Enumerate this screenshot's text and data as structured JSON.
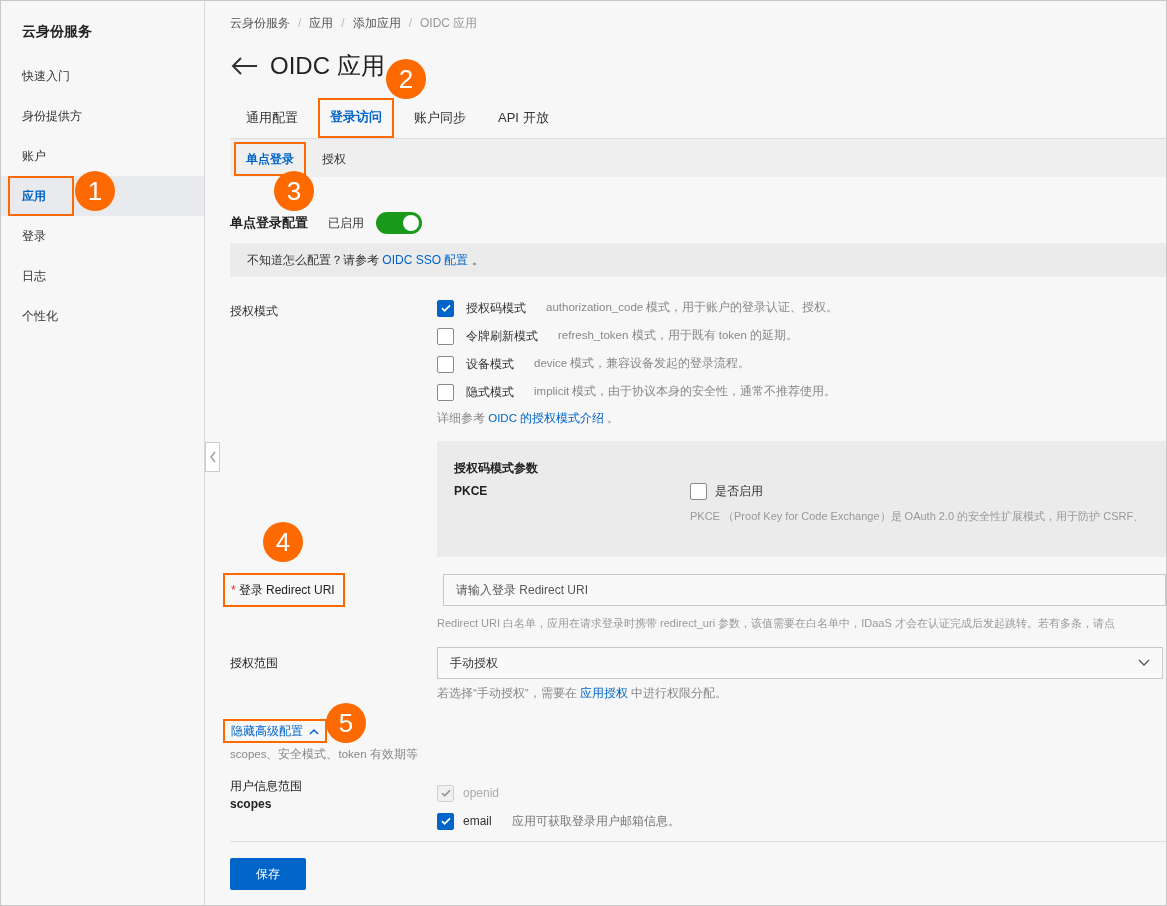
{
  "sidebar": {
    "title": "云身份服务",
    "items": [
      {
        "label": "快速入门",
        "selected": false,
        "highlighted": false
      },
      {
        "label": "身份提供方",
        "selected": false,
        "highlighted": false
      },
      {
        "label": "账户",
        "selected": false,
        "highlighted": false
      },
      {
        "label": "应用",
        "selected": true,
        "highlighted": true
      },
      {
        "label": "登录",
        "selected": false,
        "highlighted": false
      },
      {
        "label": "日志",
        "selected": false,
        "highlighted": false
      },
      {
        "label": "个性化",
        "selected": false,
        "highlighted": false
      }
    ]
  },
  "breadcrumb": [
    "云身份服务",
    "应用",
    "添加应用",
    "OIDC 应用"
  ],
  "breadcrumb_separator": "/",
  "page_title": "OIDC 应用",
  "tabs": [
    {
      "label": "通用配置",
      "selected": false,
      "highlighted": false
    },
    {
      "label": "登录访问",
      "selected": true,
      "highlighted": true
    },
    {
      "label": "账户同步",
      "selected": false,
      "highlighted": false
    },
    {
      "label": "API 开放",
      "selected": false,
      "highlighted": false
    }
  ],
  "sub_tabs": [
    {
      "label": "单点登录",
      "selected": true,
      "highlighted": true
    },
    {
      "label": "授权",
      "selected": false,
      "highlighted": false
    }
  ],
  "sso": {
    "label": "单点登录配置",
    "status": "已启用",
    "on": true
  },
  "info": {
    "text": "不知道怎么配置？请参考",
    "link": "OIDC SSO 配置",
    "suffix": "。"
  },
  "grant_modes": {
    "label": "授权模式",
    "options": [
      {
        "label": "授权码模式",
        "description": "authorization_code 模式，用于账户的登录认证、授权。",
        "checked": true
      },
      {
        "label": "令牌刷新模式",
        "description": "refresh_token 模式，用于既有 token 的延期。",
        "checked": false
      },
      {
        "label": "设备模式",
        "description": "device 模式，兼容设备发起的登录流程。",
        "checked": false
      },
      {
        "label": "隐式模式",
        "description": "implicit 模式，由于协议本身的安全性，通常不推荐使用。",
        "checked": false
      }
    ],
    "note": {
      "text": "详细参考",
      "link": "OIDC 的授权模式介绍",
      "suffix": "。"
    }
  },
  "pkce_panel": {
    "title": "授权码模式参数",
    "label": "PKCE",
    "checkbox_label": "是否启用",
    "checked": false,
    "description": "PKCE （Proof Key for Code Exchange）是 OAuth 2.0 的安全性扩展模式，用于防护 CSRF、"
  },
  "redirect_uri": {
    "label": "登录 Redirect URI",
    "required_mark": "*",
    "highlighted": true,
    "placeholder": "请输入登录 Redirect URI",
    "help": "Redirect URI 白名单，应用在请求登录时携带 redirect_uri 参数，该值需要在白名单中，IDaaS 才会在认证完成后发起跳转。若有多条，请点"
  },
  "scope": {
    "label": "授权范围",
    "value": "手动授权",
    "help": {
      "text": "若选择“手动授权”，需要在",
      "link": "应用授权",
      "suffix": "中进行权限分配。"
    }
  },
  "advanced": {
    "label": "隐藏高级配置",
    "expanded": true,
    "highlighted": true,
    "hint": "scopes、安全模式、token 有效期等"
  },
  "user_scopes": {
    "label": "用户信息范围",
    "sublabel": "scopes",
    "options": [
      {
        "label": "openid",
        "checked": true,
        "disabled": true
      },
      {
        "label": "email",
        "checked": true,
        "disabled": false,
        "description": "应用可获取登录用户邮箱信息。"
      }
    ]
  },
  "save_button": "保存",
  "callouts": [
    "1",
    "2",
    "3",
    "4",
    "5"
  ]
}
